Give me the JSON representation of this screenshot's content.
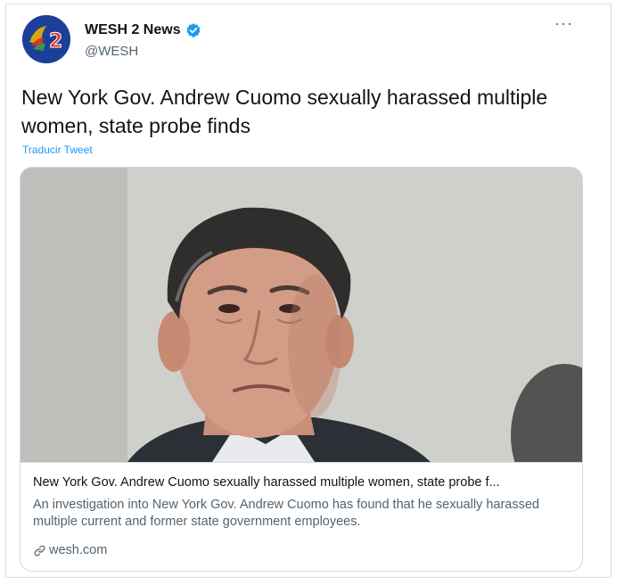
{
  "author": {
    "display_name": "WESH 2 News",
    "handle": "@WESH",
    "verified": true,
    "avatar_text": "WESH 2"
  },
  "tweet": {
    "text": "New York Gov. Andrew Cuomo sexually harassed multiple women, state probe finds",
    "translate_label": "Traducir Tweet"
  },
  "card": {
    "title": "New York Gov. Andrew Cuomo sexually harassed multiple women, state probe f...",
    "description": "An investigation into New York Gov. Andrew Cuomo has found that he sexually harassed multiple current and former state government employees.",
    "domain": "wesh.com"
  },
  "colors": {
    "link": "#1d9bf0",
    "verified": "#1d9bf0",
    "secondary_text": "#536471",
    "border": "#cfd9de"
  },
  "icons": {
    "more": "more-icon",
    "verified": "verified-badge-icon",
    "link": "link-icon"
  }
}
